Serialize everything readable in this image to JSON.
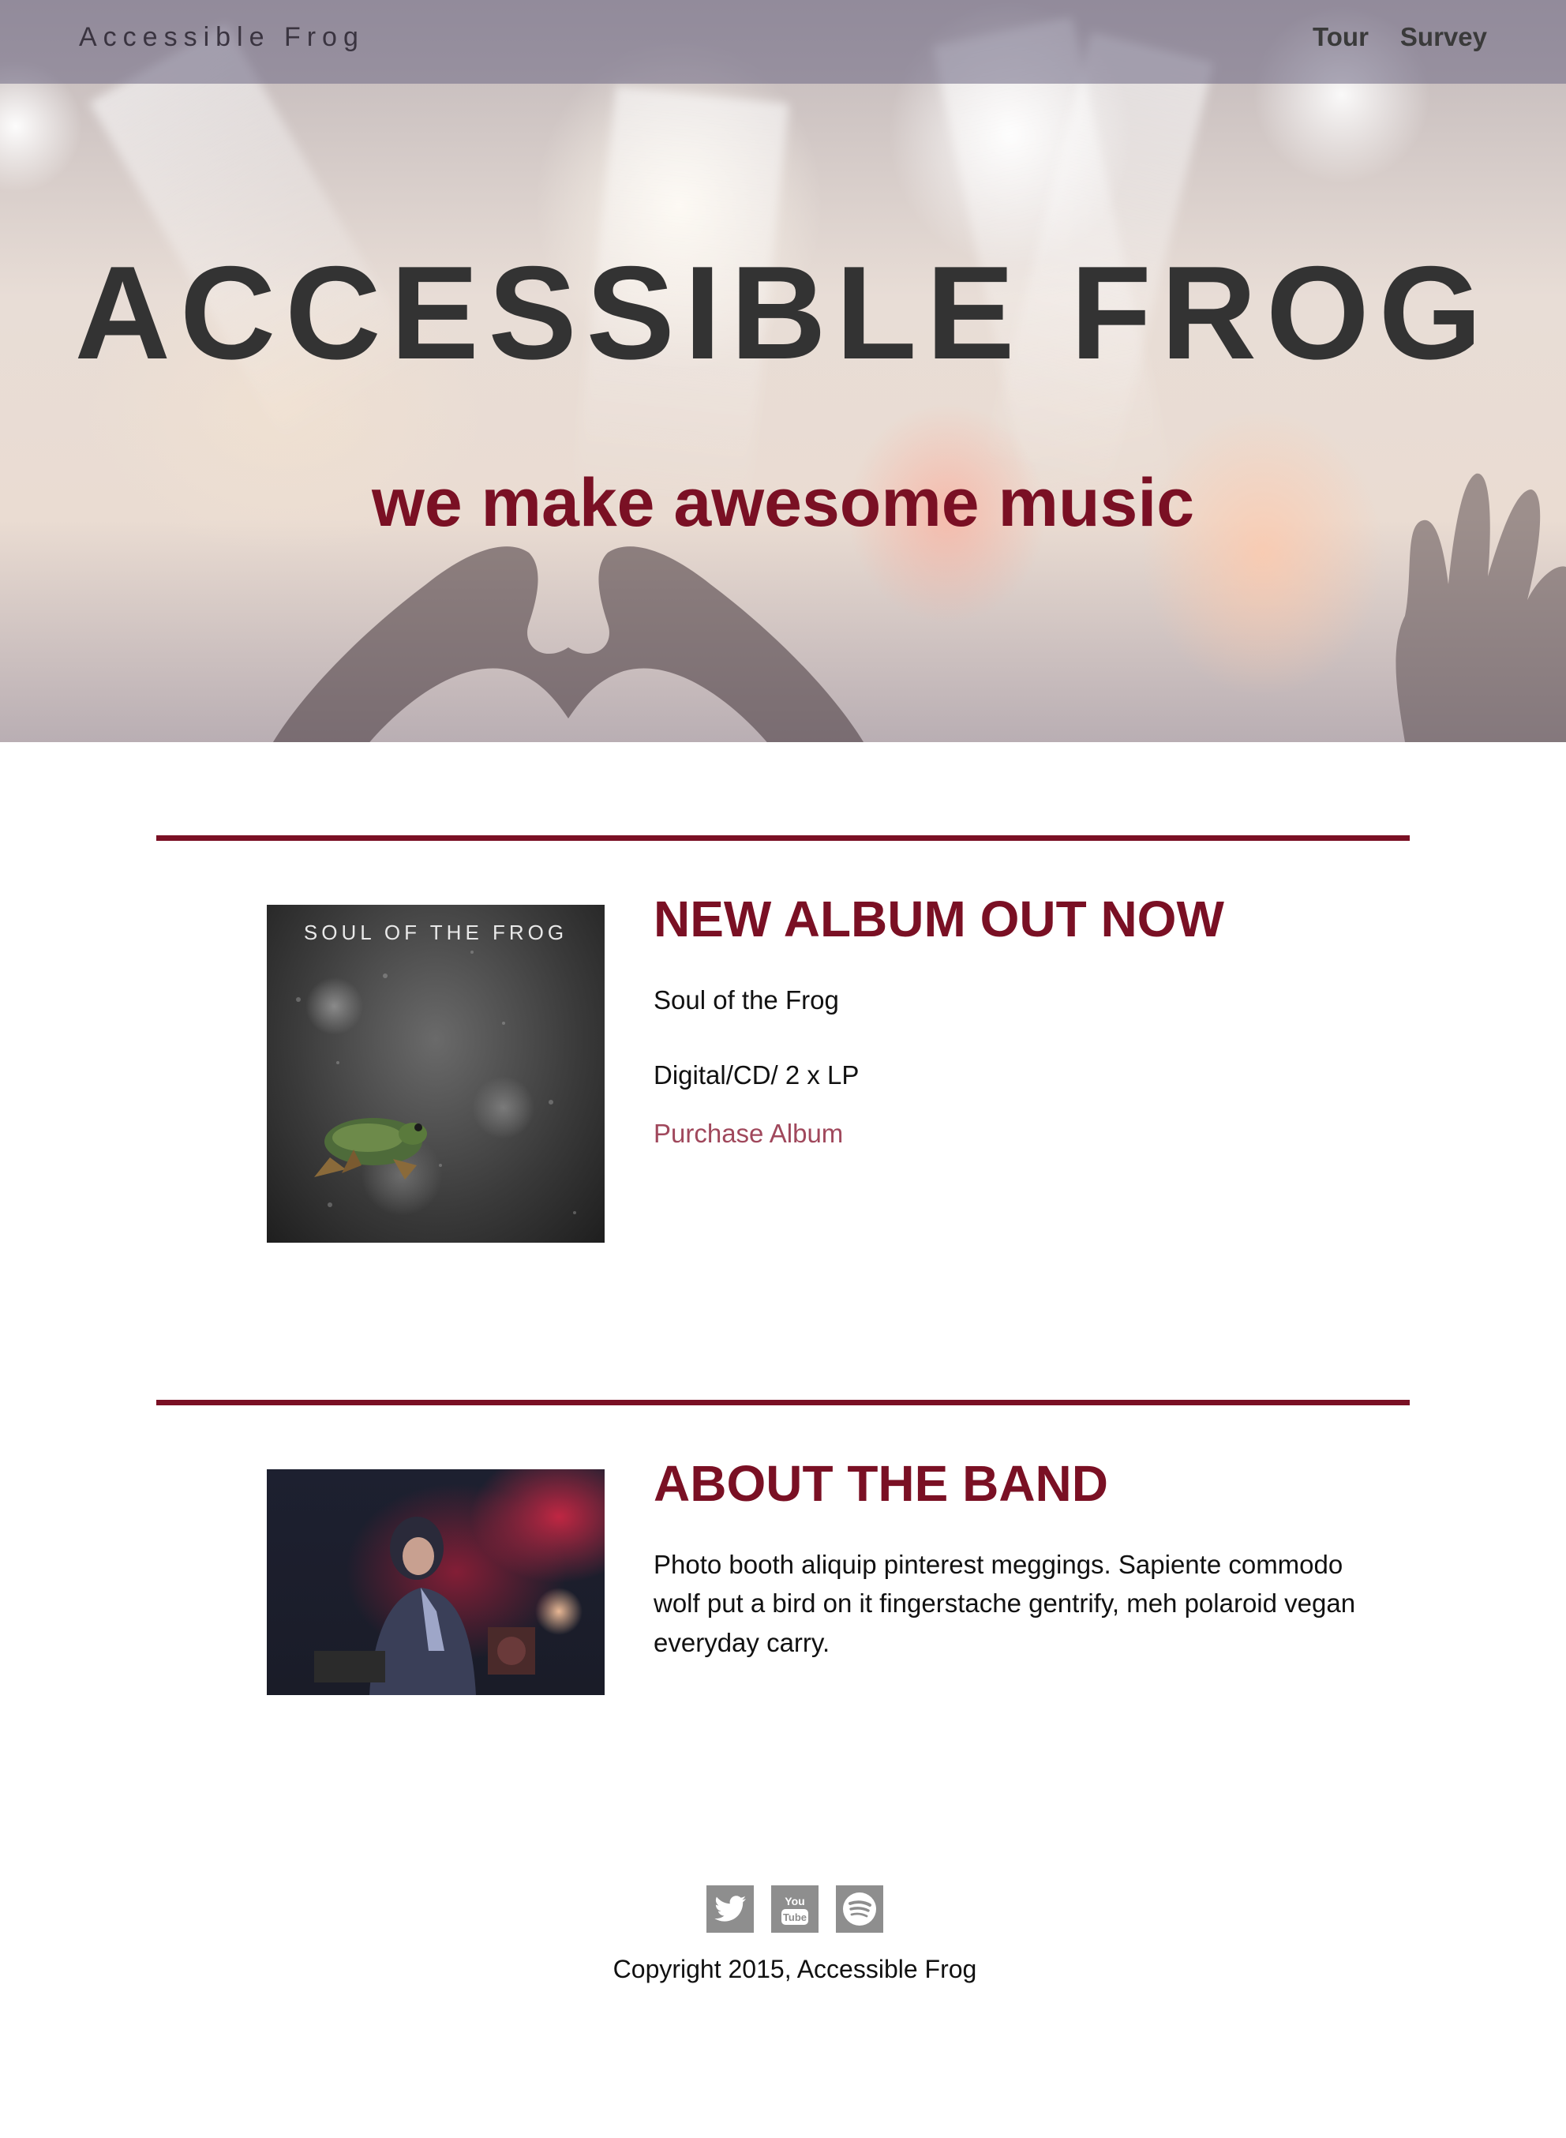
{
  "nav": {
    "brand": "Accessible Frog",
    "links": [
      {
        "label": "Tour"
      },
      {
        "label": "Survey"
      }
    ]
  },
  "hero": {
    "title": "ACCESSIBLE FROG",
    "subtitle": "we make awesome music"
  },
  "album": {
    "heading": "NEW ALBUM OUT NOW",
    "cover_title": "SOUL OF THE FROG",
    "name": "Soul of the Frog",
    "formats": "Digital/CD/ 2 x LP",
    "purchase_label": "Purchase Album"
  },
  "about": {
    "heading": "ABOUT THE BAND",
    "body": "Photo booth aliquip pinterest meggings. Sapiente commodo wolf put a bird on it fingerstache gentrify, meh polaroid vegan everyday carry."
  },
  "footer": {
    "social": [
      {
        "icon": "twitter-icon"
      },
      {
        "icon": "youtube-icon"
      },
      {
        "icon": "spotify-icon"
      }
    ],
    "copyright": "Copyright 2015, Accessible Frog"
  },
  "colors": {
    "accent": "#7a1024",
    "link": "#a0485c",
    "nav_bg": "#6e6884",
    "social_bg": "#8e8e8e"
  }
}
